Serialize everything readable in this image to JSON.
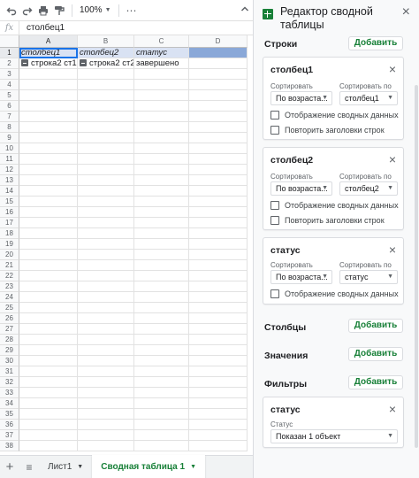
{
  "toolbar": {
    "zoom": "100%",
    "more": "⋯"
  },
  "formula_bar": {
    "fx": "fx",
    "value": "столбец1"
  },
  "grid": {
    "columns": [
      "A",
      "B",
      "C",
      "D"
    ],
    "rows": [
      "1",
      "2",
      "3",
      "4",
      "5",
      "6",
      "7",
      "8",
      "9",
      "10",
      "11",
      "12",
      "13",
      "14",
      "15",
      "16",
      "17",
      "18",
      "19",
      "20",
      "21",
      "22",
      "23",
      "24",
      "25",
      "26",
      "27",
      "28",
      "29",
      "30",
      "31",
      "32",
      "33",
      "34",
      "35",
      "36",
      "37",
      "38"
    ],
    "header_row": [
      "столбец1",
      "столбец2",
      "статус"
    ],
    "data_row": [
      "строка2 ст1",
      "строка2 ст2",
      "завершено"
    ]
  },
  "sheet_tabs": {
    "tab1": "Лист1",
    "tab2": "Сводная таблица 1"
  },
  "panel": {
    "title": "Редактор сводной таблицы",
    "rows_label": "Строки",
    "columns_label": "Столбцы",
    "values_label": "Значения",
    "filters_label": "Фильтры",
    "add_label": "Добавить",
    "sort_label": "Сортировать",
    "sort_by_label": "Сортировать по",
    "show_totals": "Отображение сводных данных",
    "repeat_labels": "Повторить заголовки строк",
    "row_cards": [
      {
        "title": "столбец1",
        "order": "По возраста...",
        "sort_by": "столбец1"
      },
      {
        "title": "столбец2",
        "order": "По возраста...",
        "sort_by": "столбец2"
      },
      {
        "title": "статус",
        "order": "По возраста...",
        "sort_by": "статус"
      }
    ],
    "filter_card": {
      "title": "статус",
      "status_label": "Статус",
      "value": "Показан 1 объект"
    }
  },
  "colors": {
    "accent_green": "#188038",
    "selection_blue": "#1a73e8",
    "header_fill": "#d9e2f3",
    "column_fill": "#8aa8d8"
  }
}
